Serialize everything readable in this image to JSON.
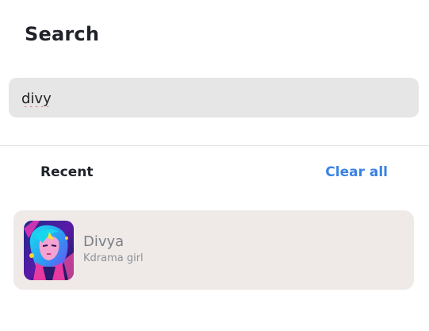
{
  "header": {
    "title": "Search"
  },
  "search": {
    "value": "divy",
    "placeholder": ""
  },
  "recent": {
    "label": "Recent",
    "clear_label": "Clear all",
    "items": [
      {
        "name": "Divya",
        "subtitle": "Kdrama girl",
        "avatar_icon": "avatar-artwork"
      }
    ]
  },
  "colors": {
    "accent": "#3a82e4",
    "search_bg": "#e6e6e6",
    "card_bg": "#efeae8",
    "text_primary": "#1f2229",
    "text_muted": "#7b7f86"
  }
}
